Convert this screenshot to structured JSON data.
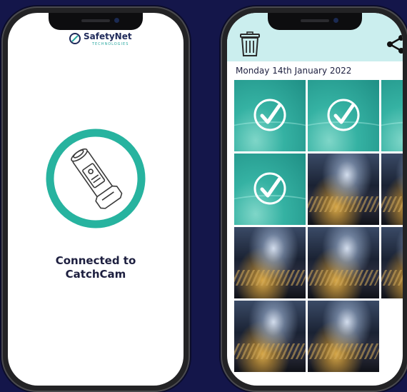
{
  "left_phone": {
    "logo_text": "SafetyNet",
    "logo_subtext": "TECHNOLOGIES",
    "status_line1": "Connected to",
    "status_line2": "CatchCam",
    "accent_color": "#27b39f"
  },
  "right_phone": {
    "date_label": "Monday 14th January 2022",
    "topbar_color": "#cbeeee",
    "icons": {
      "trash": "trash-icon",
      "share": "share-icon",
      "check": "checkmark-icon"
    },
    "tiles": [
      {
        "type": "selected",
        "checked": true
      },
      {
        "type": "selected",
        "checked": true
      },
      {
        "type": "selected",
        "checked": false
      },
      {
        "type": "selected",
        "checked": true
      },
      {
        "type": "photo",
        "checked": false
      },
      {
        "type": "photo",
        "checked": false
      },
      {
        "type": "photo",
        "checked": false
      },
      {
        "type": "photo",
        "checked": false
      },
      {
        "type": "photo",
        "checked": false
      },
      {
        "type": "photo",
        "checked": false
      },
      {
        "type": "photo",
        "checked": false
      }
    ]
  }
}
